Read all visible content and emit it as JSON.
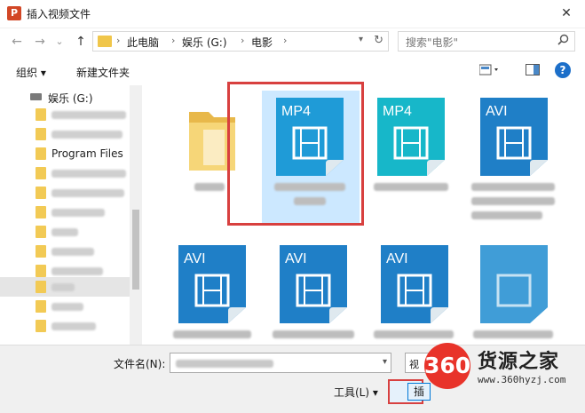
{
  "window": {
    "title": "插入视频文件",
    "close": "✕"
  },
  "nav": {
    "back": "←",
    "forward": "→",
    "history": "⌄",
    "up": "↑"
  },
  "address": {
    "segments": [
      "此电脑",
      "娱乐 (G:)",
      "电影"
    ],
    "sep": "›"
  },
  "search": {
    "placeholder": "搜索\"电影\""
  },
  "toolbar": {
    "organize": "组织 ▾",
    "new_folder": "新建文件夹",
    "help": "?"
  },
  "sidebar": {
    "drive": "娱乐 (G:)",
    "program_files": "Program Files"
  },
  "files": [
    {
      "badge": "MP4",
      "color": "#1f9bd7"
    },
    {
      "badge": "MP4",
      "color": "#1f9bd7"
    },
    {
      "badge": "AVI",
      "color": "#1f7fc7"
    },
    {
      "badge": "AVI",
      "color": "#1f7fc7"
    },
    {
      "badge": "AVI",
      "color": "#1f7fc7"
    },
    {
      "badge": "AVI",
      "color": "#1f7fc7"
    }
  ],
  "footer": {
    "filename_label": "文件名(N):",
    "type_text": "视",
    "tools": "工具(L) ▾",
    "insert": "插"
  },
  "watermark": {
    "logo": "360",
    "name": "货源之家",
    "url": "www.360hyzj.com"
  }
}
